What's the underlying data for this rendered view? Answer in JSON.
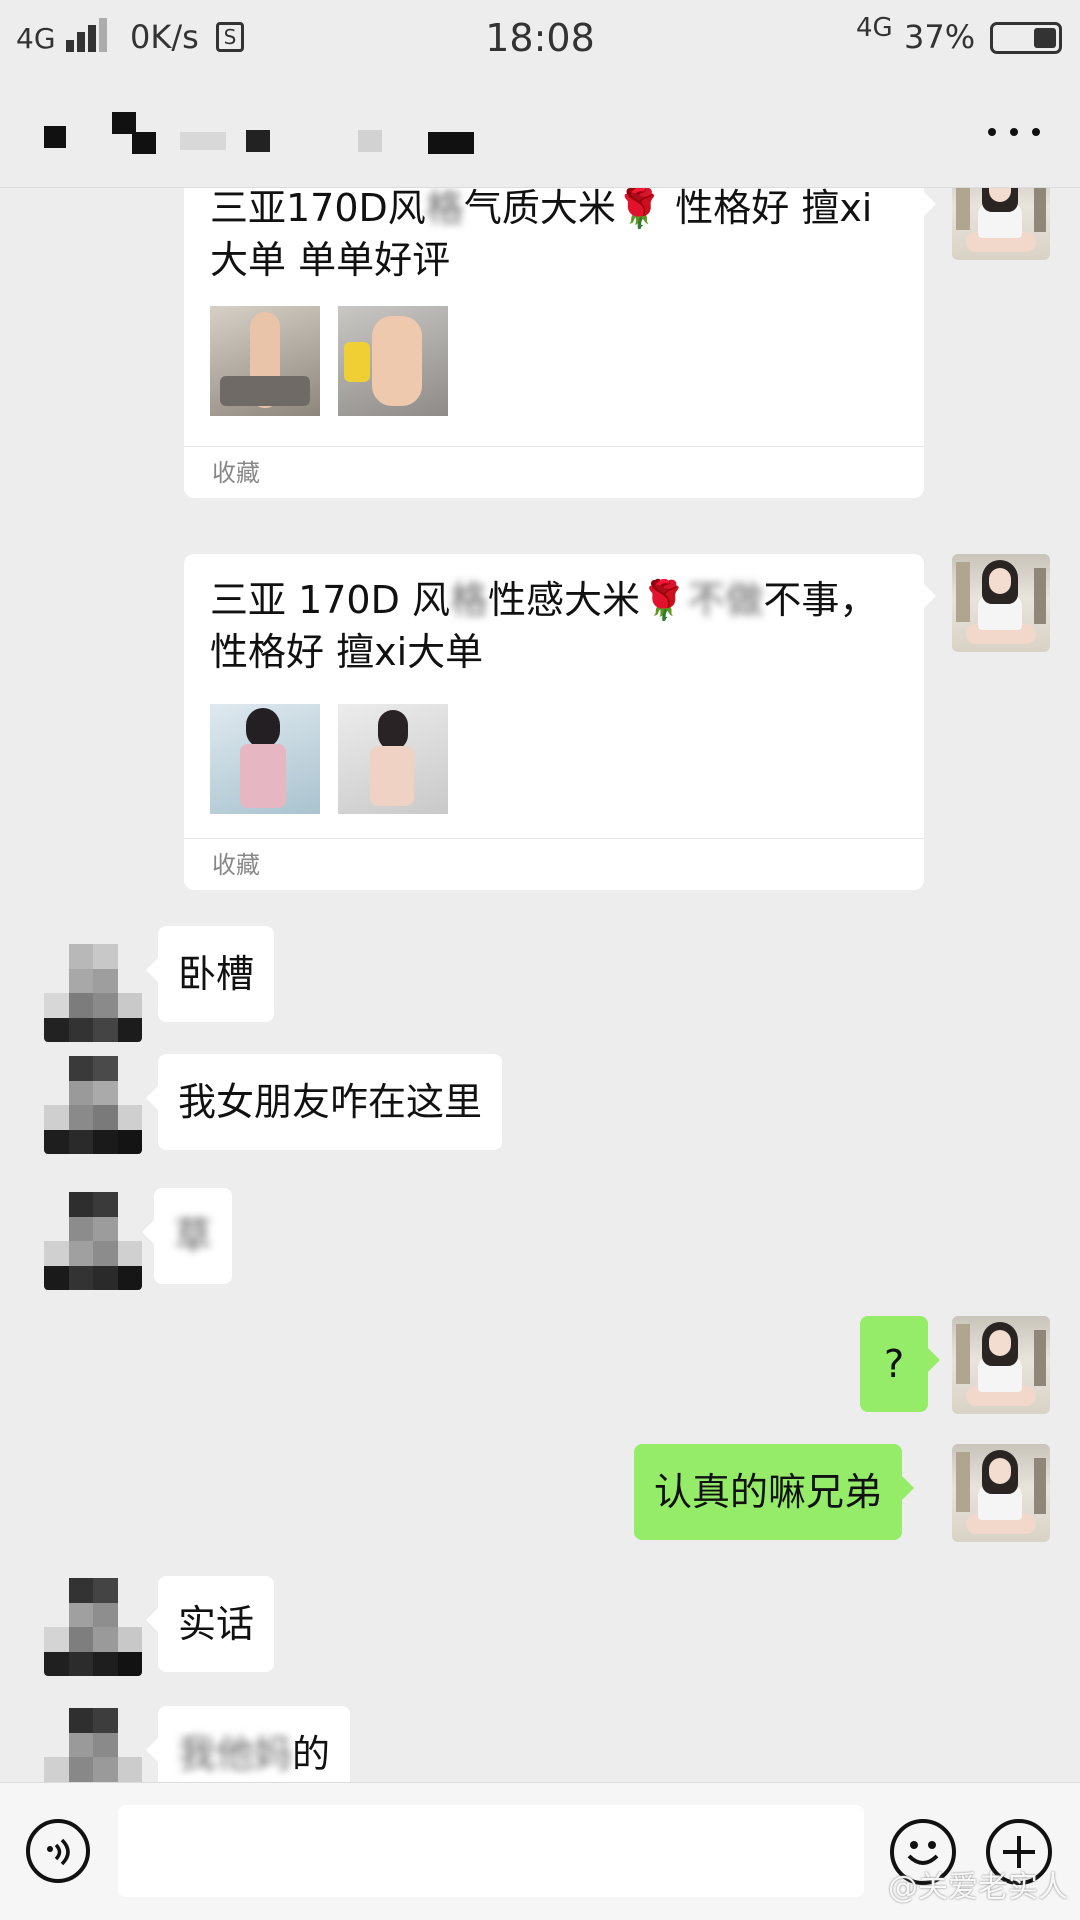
{
  "status_bar": {
    "network": "4G",
    "speed": "0K/s",
    "s_icon": "S",
    "time": "18:08",
    "net_right": "4G",
    "battery": "37%",
    "battery_level": 0.37
  },
  "title_bar": {
    "more_icon": "more-dots-icon"
  },
  "messages": [
    {
      "side": "right",
      "type": "favorite-card",
      "text_before_rose": "三亚170D风",
      "text_blur_1": "格",
      "text_mid": "气质大米",
      "rose": "🌹",
      "text_after_rose": " 性格好 擅xi大单 单单好评",
      "footer": "收藏"
    },
    {
      "side": "right",
      "type": "favorite-card",
      "text_before_rose": "三亚 170D 风",
      "text_blur_1": "格",
      "text_mid": "性感大米",
      "rose": "🌹",
      "text_blur_2": "不做",
      "text_after_rose": "不事，性格好 擅xi大单",
      "footer": "收藏"
    },
    {
      "side": "left",
      "text": "卧槽"
    },
    {
      "side": "left",
      "text": "我女朋友咋在这里"
    },
    {
      "side": "left",
      "text": "草",
      "blurred": true
    },
    {
      "side": "right",
      "text": "?"
    },
    {
      "side": "right",
      "text": "认真的嘛兄弟"
    },
    {
      "side": "left",
      "text": "实话"
    },
    {
      "side": "left",
      "text_blurred": "我他妈",
      "text": "的"
    }
  ],
  "input_bar": {
    "voice_icon": "voice-icon",
    "emoji_icon": "emoji-icon",
    "plus_icon": "plus-icon",
    "input_value": ""
  },
  "watermark": "@关爱老实人",
  "colors": {
    "background": "#ededed",
    "bubble_sent": "#95ec69",
    "bubble_received": "#ffffff"
  }
}
